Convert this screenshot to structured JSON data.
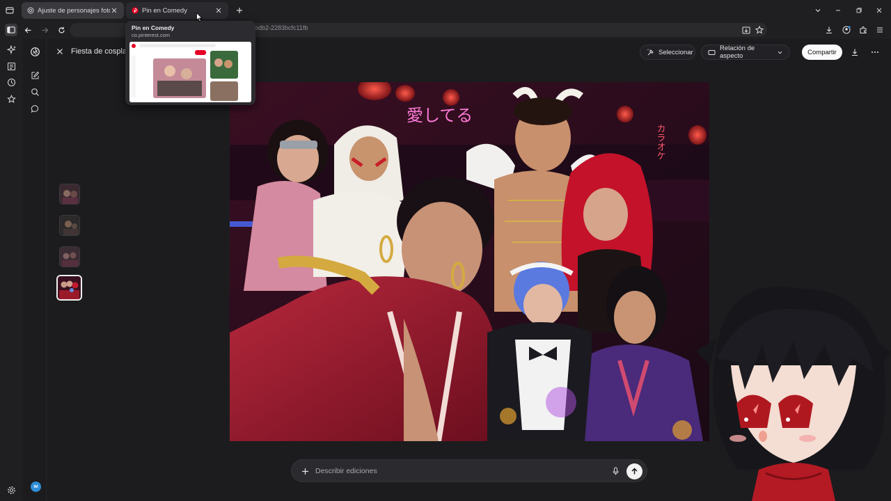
{
  "tabs": [
    {
      "label": "Ajuste de personajes fotos",
      "active": false
    },
    {
      "label": "Pin en Comedy",
      "active": true
    }
  ],
  "address": {
    "url_partial": "odb2-2283bcfc11fb"
  },
  "tab_preview": {
    "title": "Pin en Comedy",
    "domain": "co.pinterest.com"
  },
  "editor": {
    "title": "Fiesta de cosplay",
    "select_label": "Seleccionar",
    "aspect_label": "Relación de aspecto",
    "share_label": "Compartir"
  },
  "prompt": {
    "placeholder": "Describir ediciones",
    "value": ""
  },
  "user": {
    "initials": "IM"
  },
  "image": {
    "neon_sign_1": "愛してる",
    "neon_sign_2": "カラオケ"
  },
  "colors": {
    "accent_share_bg": "#fafafa",
    "avatar": "#2e8ed8",
    "pinterest_red": "#e60023"
  }
}
